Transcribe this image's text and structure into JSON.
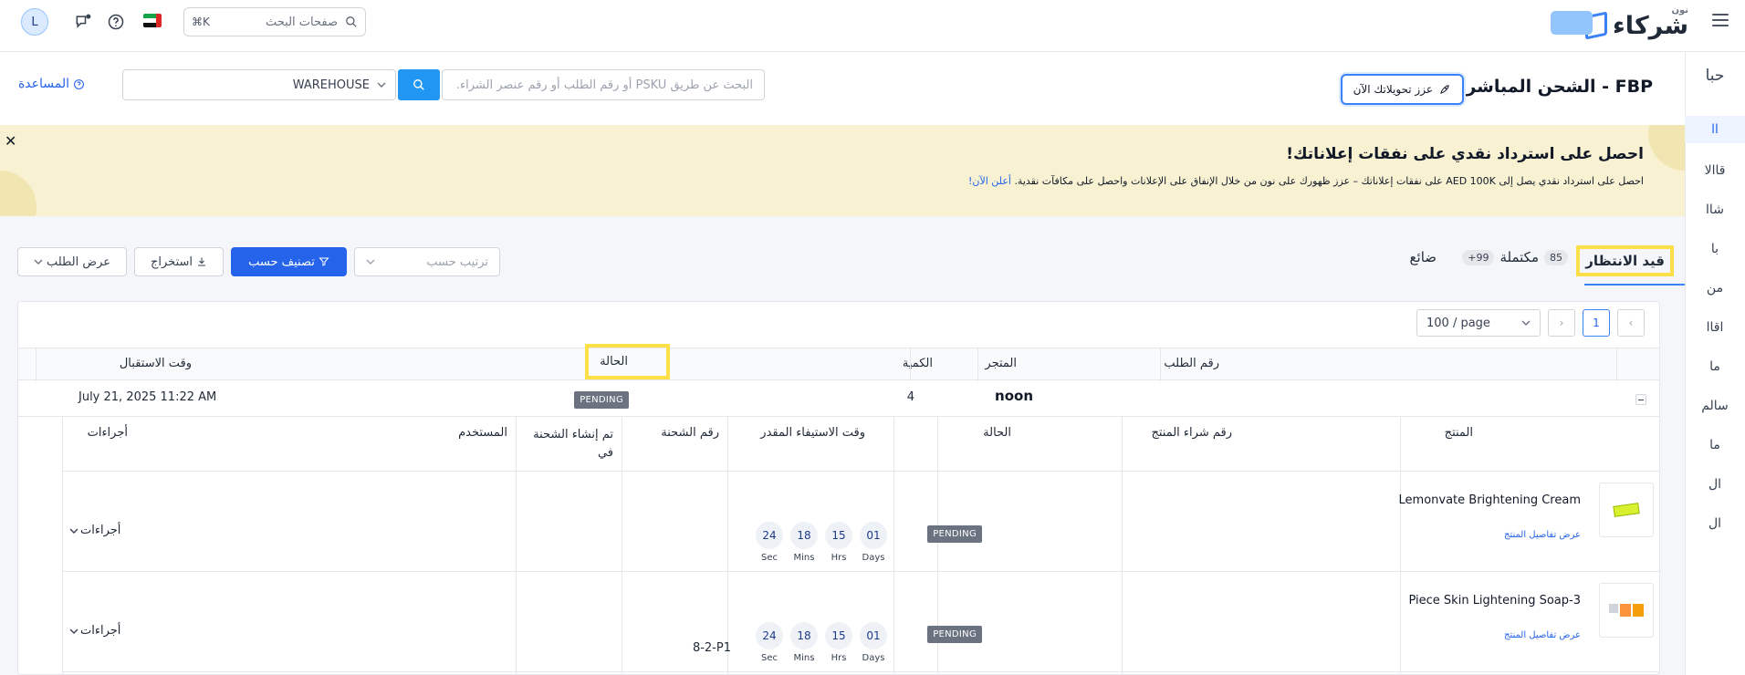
{
  "topbar": {
    "logo_text": "شركاء",
    "logo_sub": "نون",
    "search_placeholder": "صفحات البحث",
    "shortcut": "⌘K",
    "avatar_initial": "L"
  },
  "sidenav": {
    "items": [
      "حبا",
      "اا",
      "قاالا",
      "شاا",
      "با",
      "من",
      "اقاا",
      "ما",
      "سالم",
      "ما",
      "ال",
      "ال"
    ]
  },
  "header": {
    "title": "FBP - الشحن المباشر",
    "boost_label": "عزز تحويلاتك الآن",
    "search_placeholder": "البحث عن طريق PSKU أو رقم الطلب أو رقم عنصر الشراء.",
    "warehouse_value": "WAREHOUSE",
    "help_label": "المساعدة"
  },
  "banner": {
    "title": "احصل على استرداد نقدي على نفقات إعلاناتك!",
    "text": "احصل على استرداد نقدي يصل إلى AED 100K على نفقات إعلاناتك – عزز ظهورك على نون من خلال الإنفاق على الإعلانات واحصل على مكافآت نقدية.",
    "link": "أعلن الآن!"
  },
  "tabs": {
    "pending": "قيد الانتظار",
    "pending_count": "85",
    "completed": "مكتملة",
    "completed_count": "99+",
    "lost": "ضائع"
  },
  "controls": {
    "sort_placeholder": "ترتيب حسب",
    "classify_label": "تصنيف حسب",
    "export_label": "استخراج",
    "view_label": "عرض الطلب"
  },
  "pager": {
    "current": "1",
    "page_size": "100 / page"
  },
  "table": {
    "headers": {
      "order_no": "رقم الطلب",
      "store": "المتجر",
      "quantity": "الكمية",
      "status": "الحالة",
      "received_time": "وقت الاستقبال"
    },
    "order": {
      "quantity": "4",
      "status": "PENDING",
      "received": "July 21, 2025 11:22 AM",
      "store_logo": "noon"
    }
  },
  "subtable": {
    "headers": {
      "product": "المنتج",
      "po_no": "رقم شراء المنتج",
      "status": "الحالة",
      "eta": "وقت الاستيفاء المقدر",
      "shipment_no": "رقم الشحنة",
      "shipment_created": "تم إنشاء الشحنة في",
      "user": "المستخدم",
      "actions": "أجراءات"
    },
    "detail_link": "عرض تفاصيل المنتج",
    "timer_labels": {
      "days": "Days",
      "hrs": "Hrs",
      "mins": "Mins",
      "sec": "Sec"
    },
    "rows": [
      {
        "name": "Lemonvate Brightening Cream",
        "po": "",
        "status": "PENDING",
        "timer": {
          "days": "01",
          "hrs": "15",
          "mins": "18",
          "sec": "24"
        },
        "actions": "أجراءات"
      },
      {
        "name": "Piece Skin Lightening Soap-3",
        "po": "8-2-P1",
        "status": "PENDING",
        "timer": {
          "days": "01",
          "hrs": "15",
          "mins": "18",
          "sec": "24"
        },
        "actions": "أجراءات"
      }
    ]
  },
  "colors": {
    "primary": "#2563eb",
    "highlight": "#fde047",
    "banner_bg": "#f8f2d3",
    "pending_badge": "#6b7280"
  }
}
